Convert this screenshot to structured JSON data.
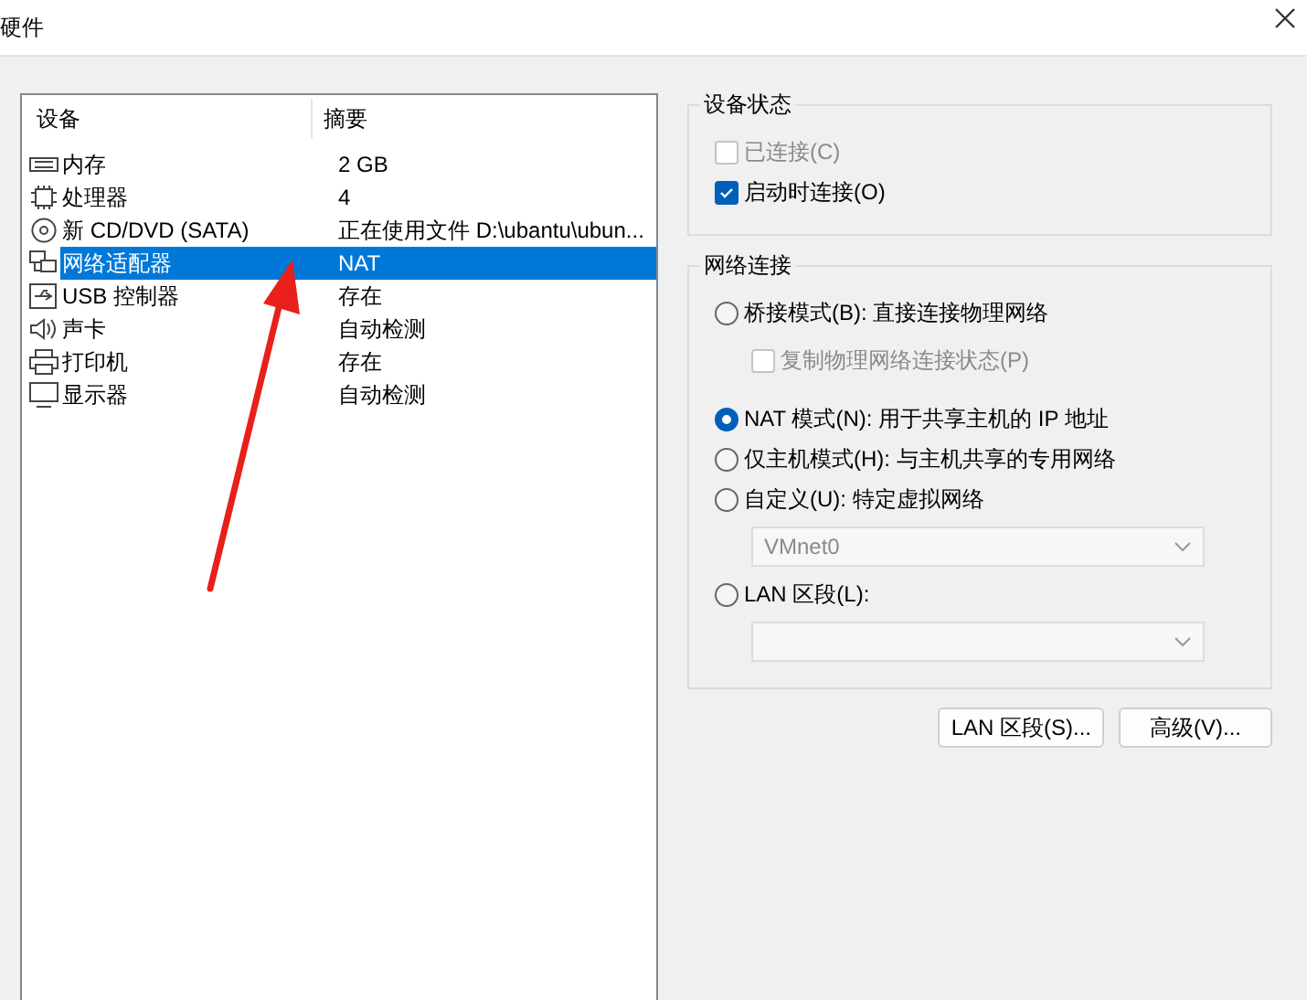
{
  "window": {
    "title": "硬件"
  },
  "device_list": {
    "columns": [
      "设备",
      "摘要"
    ],
    "rows": [
      {
        "kind": "memory",
        "device": "内存",
        "summary": "2 GB",
        "selected": false
      },
      {
        "kind": "cpu",
        "device": "处理器",
        "summary": "4",
        "selected": false
      },
      {
        "kind": "disc",
        "device": "新 CD/DVD (SATA)",
        "summary": "正在使用文件 D:\\ubantu\\ubun...",
        "selected": false
      },
      {
        "kind": "network",
        "device": "网络适配器",
        "summary": "NAT",
        "selected": true
      },
      {
        "kind": "usb",
        "device": "USB 控制器",
        "summary": "存在",
        "selected": false
      },
      {
        "kind": "sound",
        "device": "声卡",
        "summary": "自动检测",
        "selected": false
      },
      {
        "kind": "printer",
        "device": "打印机",
        "summary": "存在",
        "selected": false
      },
      {
        "kind": "display",
        "device": "显示器",
        "summary": "自动检测",
        "selected": false
      }
    ]
  },
  "device_status": {
    "title": "设备状态",
    "options": [
      {
        "label": "已连接(C)",
        "checked": false,
        "disabled": true
      },
      {
        "label": "启动时连接(O)",
        "checked": true,
        "disabled": false
      }
    ]
  },
  "network_connection": {
    "title": "网络连接",
    "items": [
      {
        "kind": "radio",
        "label": "桥接模式(B): 直接连接物理网络",
        "selected": false
      },
      {
        "kind": "checkbox",
        "label": "复制物理网络连接状态(P)",
        "checked": false,
        "disabled": true
      },
      {
        "kind": "radio",
        "label": "NAT 模式(N): 用于共享主机的 IP 地址",
        "selected": true
      },
      {
        "kind": "radio",
        "label": "仅主机模式(H): 与主机共享的专用网络",
        "selected": false
      },
      {
        "kind": "radio",
        "label": "自定义(U): 特定虚拟网络",
        "selected": false
      },
      {
        "kind": "dropdown",
        "value": "VMnet0",
        "disabled": true
      },
      {
        "kind": "radio",
        "label": "LAN 区段(L):",
        "selected": false
      },
      {
        "kind": "dropdown",
        "disabled": true
      }
    ]
  },
  "buttons": [
    "LAN 区段(S)...",
    "高级(V)..."
  ]
}
